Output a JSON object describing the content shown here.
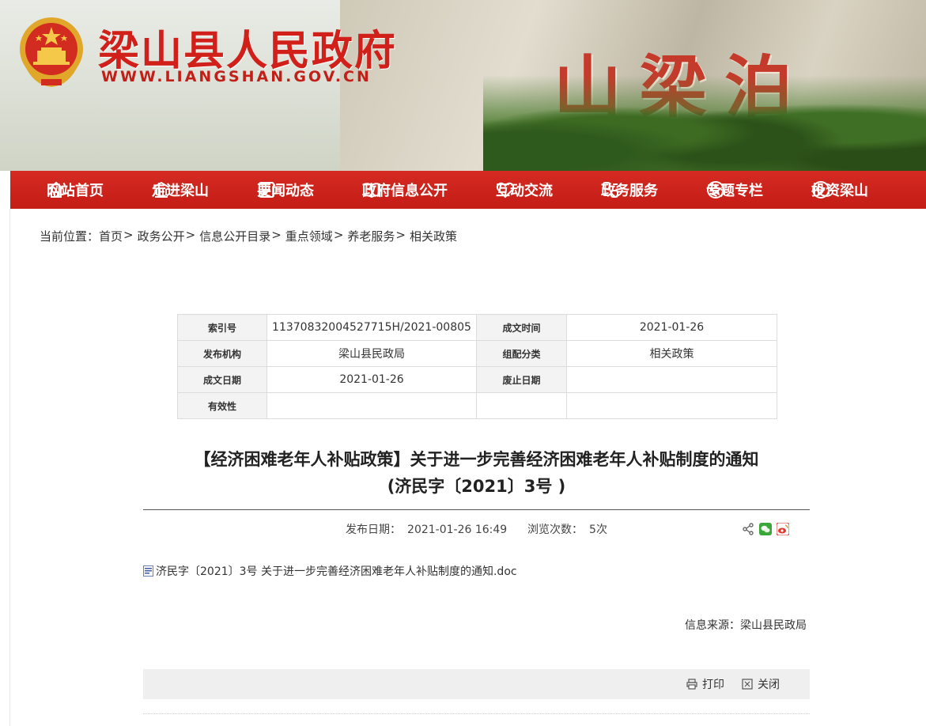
{
  "header": {
    "site_title": "梁山县人民政府",
    "site_url": "WWW.LIANGSHAN.GOV.CN",
    "carved_text": "山梁泊"
  },
  "nav": {
    "items": [
      {
        "label": "网站首页",
        "icon": "home-icon"
      },
      {
        "label": "走进梁山",
        "icon": "building-icon"
      },
      {
        "label": "要闻动态",
        "icon": "news-icon"
      },
      {
        "label": "政府信息公开",
        "icon": "book-icon"
      },
      {
        "label": "互动交流",
        "icon": "heart-icon"
      },
      {
        "label": "政务服务",
        "icon": "service-icon"
      },
      {
        "label": "专题专栏",
        "icon": "star-icon"
      },
      {
        "label": "投资梁山",
        "icon": "invest-icon"
      }
    ]
  },
  "breadcrumb": {
    "prefix": "当前位置：",
    "items": [
      "首页",
      "政务公开",
      "信息公开目录",
      "重点领域",
      "养老服务",
      "相关政策"
    ],
    "separator": ">"
  },
  "meta": {
    "index_label": "索引号",
    "index_value": "11370832004527715H/2021-00805",
    "created_time_label": "成文时间",
    "created_time_value": "2021-01-26",
    "publisher_label": "发布机构",
    "publisher_value": "梁山县民政局",
    "category_label": "组配分类",
    "category_value": "相关政策",
    "created_date_label": "成文日期",
    "created_date_value": "2021-01-26",
    "expiry_label": "废止日期",
    "expiry_value": "",
    "validity_label": "有效性",
    "validity_value": ""
  },
  "article": {
    "title_line1": "【经济困难老年人补贴政策】关于进一步完善经济困难老年人补贴制度的通知",
    "title_line2": "(济民字〔2021〕3号 )",
    "pub_date_label": "发布日期：",
    "pub_date_value": "2021-01-26 16:49",
    "views_label": "浏览次数：",
    "views_value": "5次",
    "attachment": "济民字〔2021〕3号  关于进一步完善经济困难老年人补贴制度的通知.doc",
    "source_label": "信息来源：",
    "source_value": "梁山县民政局"
  },
  "actions": {
    "print": "打印",
    "close": "关闭"
  },
  "colors": {
    "brand_red": "#c41d16",
    "title_red": "#d1201a"
  }
}
